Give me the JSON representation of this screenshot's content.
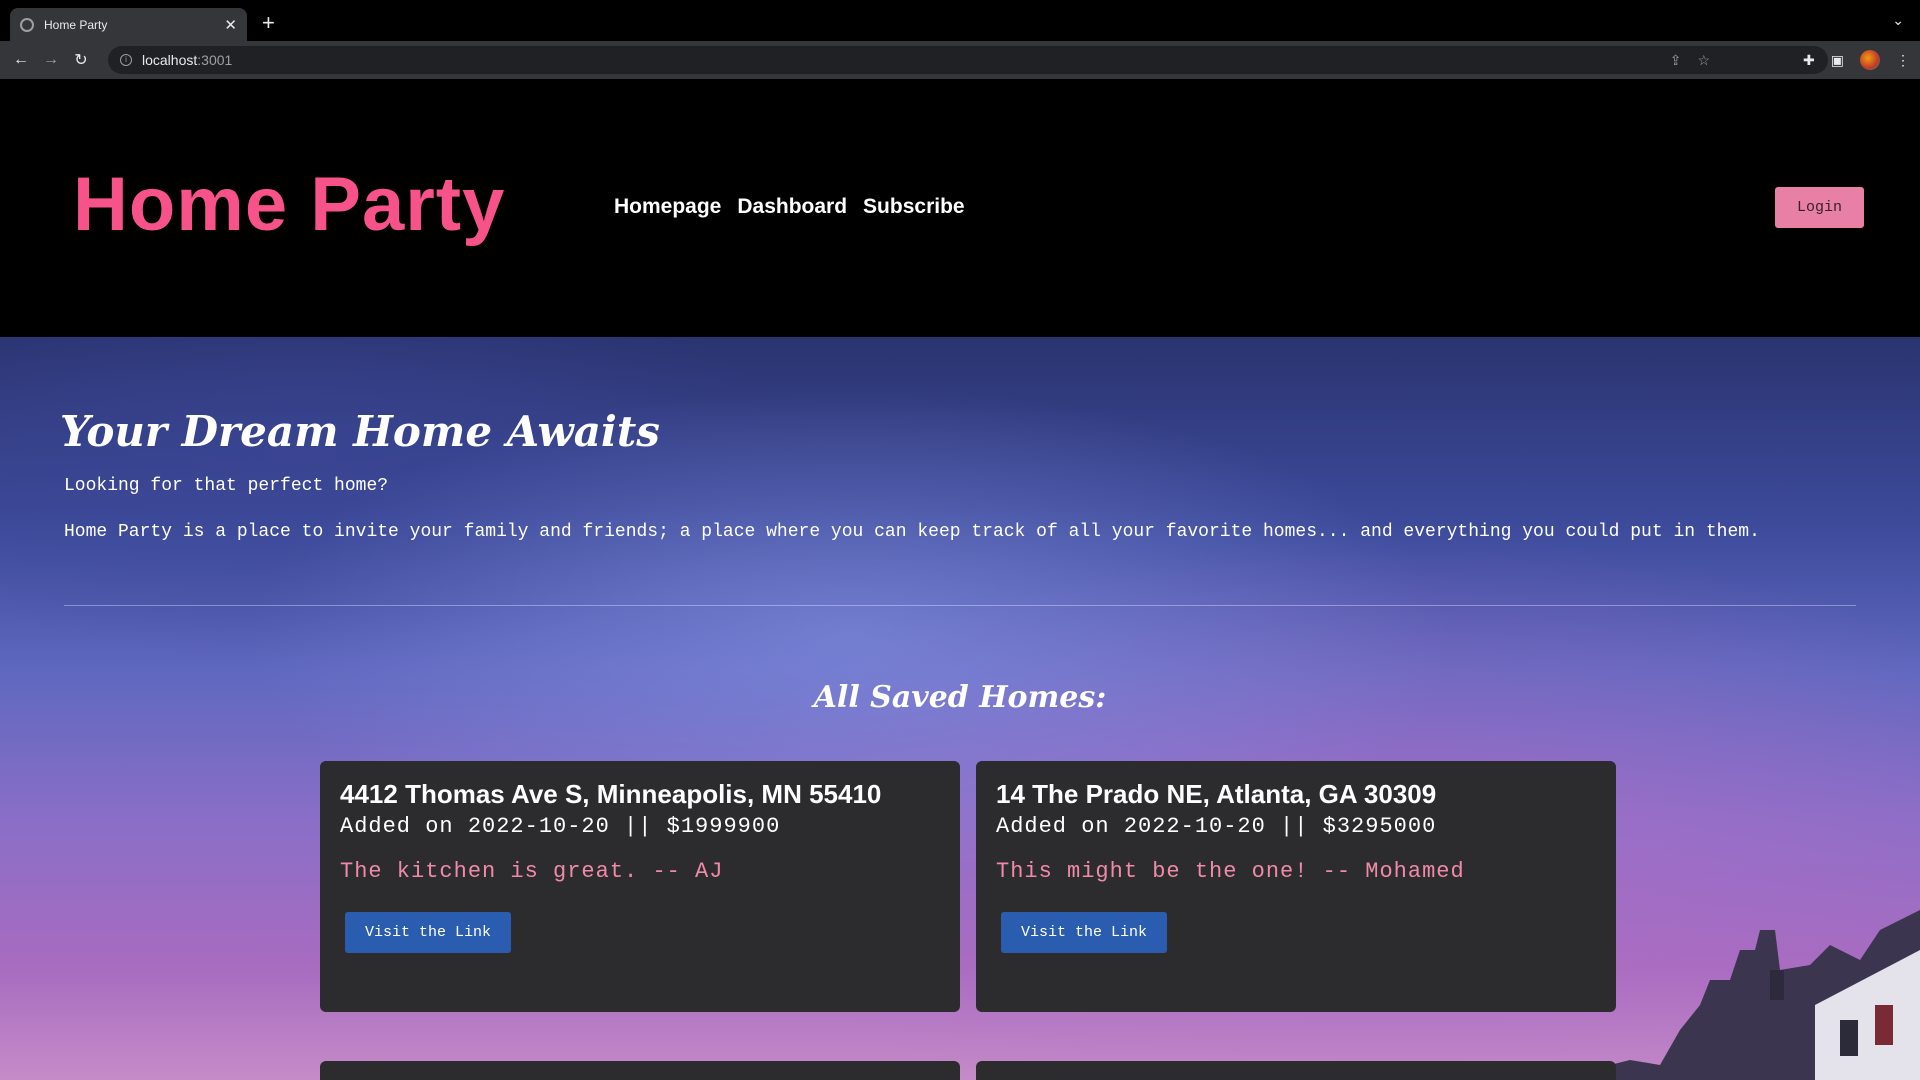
{
  "browser": {
    "tab_title": "Home Party",
    "url_host": "localhost",
    "url_port": ":3001"
  },
  "header": {
    "brand": "Home Party",
    "nav": [
      "Homepage",
      "Dashboard",
      "Subscribe"
    ],
    "login_label": "Login"
  },
  "hero": {
    "title": "Your Dream Home Awaits",
    "intro": "Looking for that perfect home?",
    "description": "Home Party is a place to invite your family and friends; a place where you can keep track of all your favorite homes... and everything you could put in them.",
    "saved_title": "All Saved Homes:"
  },
  "homes": [
    {
      "address": "4412 Thomas Ave S, Minneapolis, MN 55410",
      "meta": "Added on 2022-10-20 || $1999900",
      "note": "The kitchen is great. -- AJ",
      "link_label": "Visit the Link"
    },
    {
      "address": "14 The Prado NE, Atlanta, GA 30309",
      "meta": "Added on 2022-10-20 || $3295000",
      "note": "This might be the one! -- Mohamed",
      "link_label": "Visit the Link"
    }
  ],
  "colors": {
    "brand": "#f7538a",
    "note": "#f08aa8",
    "button": "#2a5db0",
    "login": "#e87fa5"
  }
}
